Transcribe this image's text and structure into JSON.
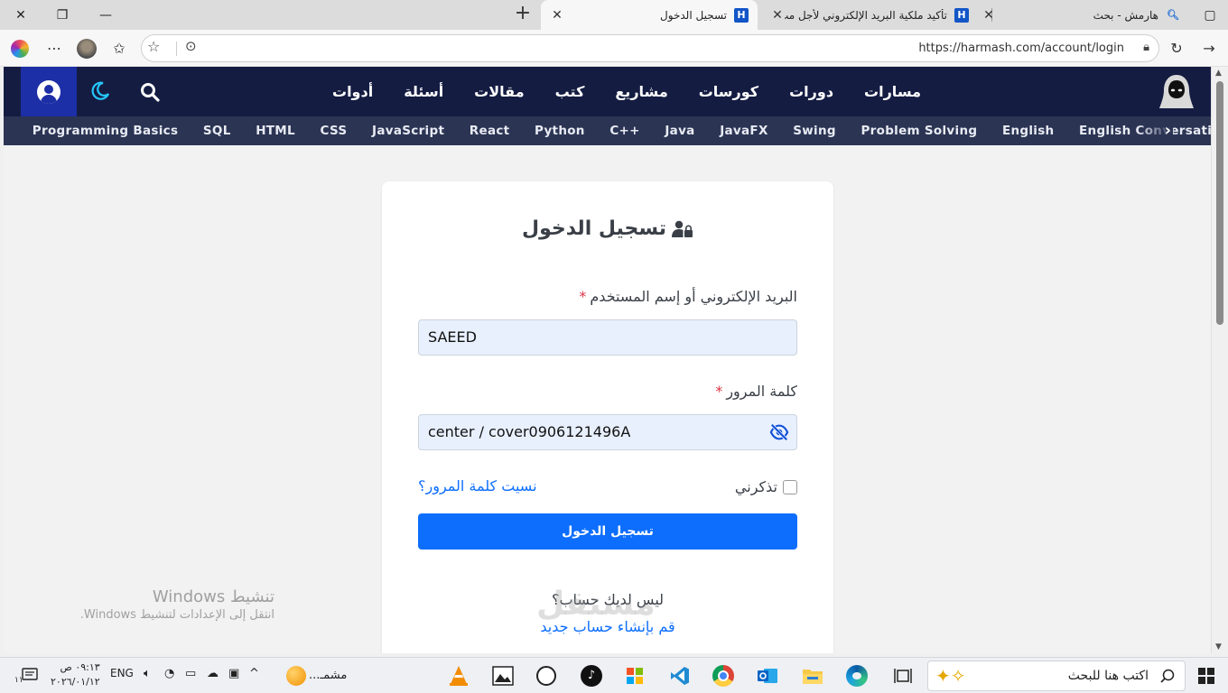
{
  "browser": {
    "tabs": [
      {
        "title": "هارمش - بحث",
        "favicon": "search-icon"
      },
      {
        "title": "تأكيد ملكية البريد الإلكتروني لأجل مت",
        "favicon": "harmash-h-icon"
      },
      {
        "title": "تسجيل الدخول",
        "favicon": "harmash-h-icon"
      }
    ],
    "url": "https://harmash.com/account/login"
  },
  "site": {
    "main_menu": [
      "مسارات",
      "دورات",
      "كورسات",
      "مشاريع",
      "كتب",
      "مقالات",
      "أسئلة",
      "أدوات"
    ],
    "sub_menu": [
      "Programming Basics",
      "SQL",
      "HTML",
      "CSS",
      "JavaScript",
      "React",
      "Python",
      "C++",
      "Java",
      "JavaFX",
      "Swing",
      "Problem Solving",
      "English",
      "English Conversation"
    ]
  },
  "login": {
    "title": "تسجيل الدخول",
    "username_label": "البريد الإلكتروني أو إسم المستخدم",
    "username_value": "SAEED",
    "password_label": "كلمة المرور",
    "password_value": "center / cover0906121496A",
    "required_mark": "*",
    "remember_label": "تذكرني",
    "remember_checked": false,
    "forgot_link": "نسيت كلمة المرور؟",
    "submit_label": "تسجيل الدخول",
    "no_account_text": "ليس لديك حساب؟",
    "create_account_link": "قم بإنشاء حساب جديد"
  },
  "watermark": "مستقل",
  "windows_activation": {
    "title": "تنشيط Windows",
    "subtitle": "انتقل إلى الإعدادات لتنشيط Windows."
  },
  "taskbar": {
    "time": "٠٩:١٣ ص",
    "date": "٢٠٢٦/٠١/١٢",
    "language": "ENG",
    "notification_count": "١١",
    "running_app_label": "مشمـ...",
    "search_placeholder": "اكتب هنا للبحث"
  },
  "colors": {
    "nav_bg": "#141c42",
    "subnav_bg": "#2b3453",
    "accent": "#0d6efd",
    "user_btn": "#1c2fa6"
  }
}
